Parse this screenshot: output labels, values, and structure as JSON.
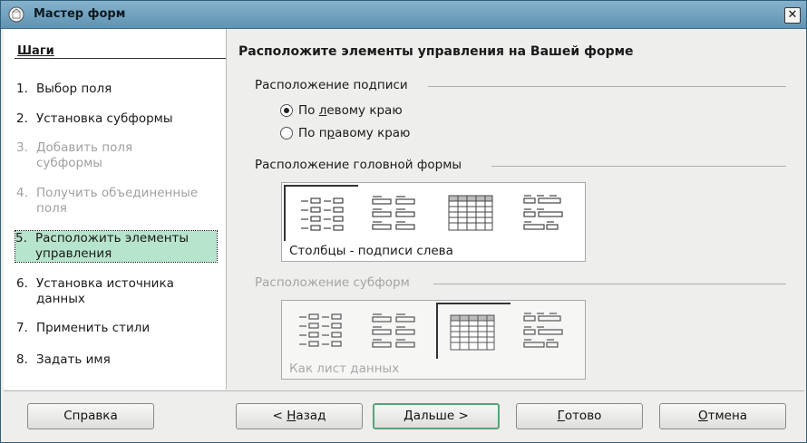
{
  "window": {
    "title": "Мастер форм"
  },
  "sidebar": {
    "title": "Шаги",
    "steps": [
      {
        "num": "1.",
        "label": "Выбор поля",
        "state": "enabled"
      },
      {
        "num": "2.",
        "label": "Установка субформы",
        "state": "enabled"
      },
      {
        "num": "3.",
        "label": "Добавить поля субформы",
        "state": "disabled"
      },
      {
        "num": "4.",
        "label": "Получить объединенные поля",
        "state": "disabled"
      },
      {
        "num": "5.",
        "label": "Расположить элементы управления",
        "state": "current"
      },
      {
        "num": "6.",
        "label": "Установка источника данных",
        "state": "enabled"
      },
      {
        "num": "7.",
        "label": "Применить стили",
        "state": "enabled"
      },
      {
        "num": "8.",
        "label": "Задать имя",
        "state": "enabled"
      }
    ]
  },
  "main": {
    "heading": "Расположите элементы управления на Вашей форме",
    "label_group": {
      "title": "Расположение подписи",
      "options": [
        {
          "pre": "По ",
          "accel": "л",
          "post": "евому краю",
          "checked": true
        },
        {
          "pre": "По п",
          "accel": "р",
          "post": "авому краю",
          "checked": false
        }
      ]
    },
    "main_form": {
      "title": "Расположение головной формы",
      "selected_caption": "Столбцы - подписи слева",
      "selected_index": 0,
      "layouts": [
        "columns-left-icon",
        "columns-top-icon",
        "datasheet-icon",
        "blocks-top-icon"
      ]
    },
    "subform": {
      "title": "Расположение субформ",
      "selected_caption": "Как лист данных",
      "selected_index": 2,
      "disabled": true,
      "layouts": [
        "columns-left-icon",
        "columns-top-icon",
        "datasheet-icon",
        "blocks-top-icon"
      ]
    }
  },
  "footer": {
    "help": {
      "pre": "Справка",
      "accel": "",
      "post": ""
    },
    "back": {
      "pre": "< ",
      "accel": "Н",
      "post": "азад"
    },
    "next": {
      "pre": "",
      "accel": "Д",
      "post": "альше >"
    },
    "finish": {
      "pre": "",
      "accel": "Г",
      "post": "отово"
    },
    "cancel": {
      "pre": "",
      "accel": "О",
      "post": "тмена"
    }
  }
}
